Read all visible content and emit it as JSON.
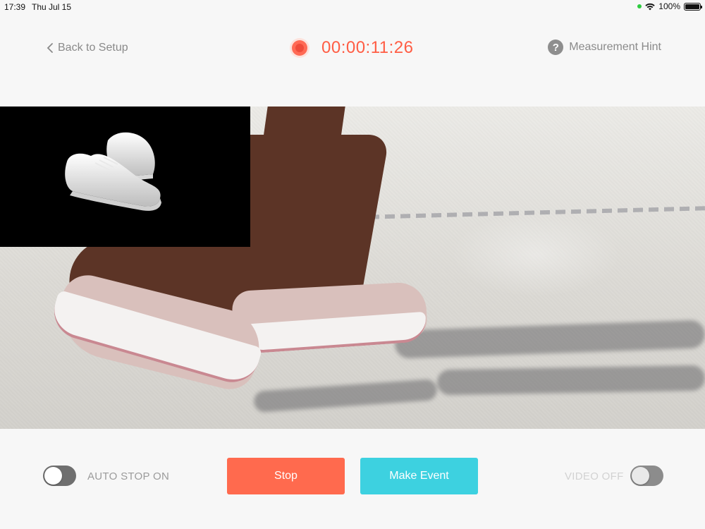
{
  "status_bar": {
    "time": "17:39",
    "date": "Thu Jul 15",
    "battery": "100%"
  },
  "header": {
    "back_label": "Back to Setup",
    "timer": "00:00:11:26",
    "hint_label": "Measurement Hint",
    "hint_icon": "question-icon"
  },
  "controls": {
    "auto_stop_label": "AUTO STOP ON",
    "auto_stop_on": false,
    "stop_label": "Stop",
    "event_label": "Make Event",
    "video_label": "VIDEO OFF",
    "video_on": false
  },
  "colors": {
    "accent_red": "#ff6a4e",
    "accent_cyan": "#3dd1e0",
    "timer_color": "#ff5d44",
    "muted_text": "#8a8a8a"
  }
}
